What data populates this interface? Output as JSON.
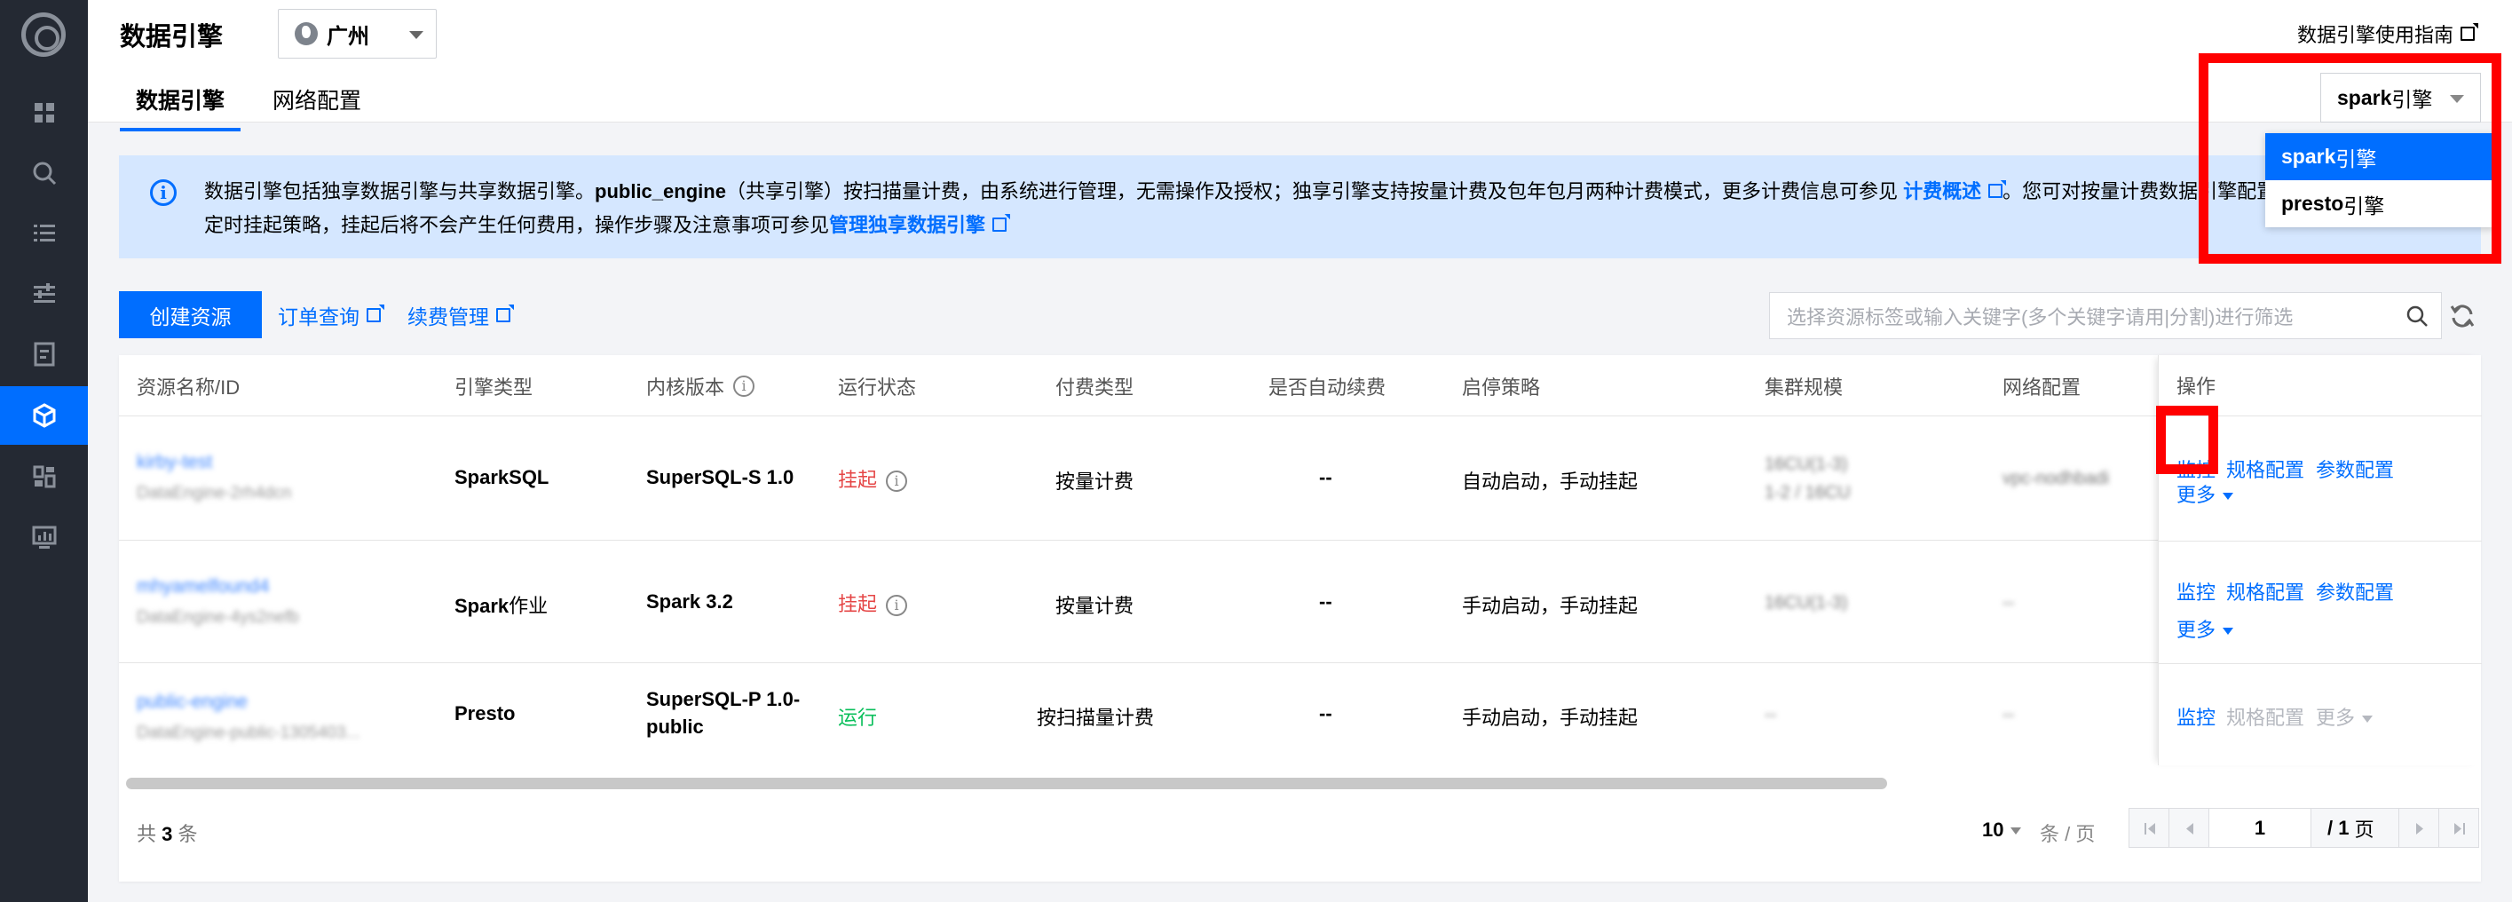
{
  "colors": {
    "primary": "#006eff",
    "nav_bg": "#242933",
    "banner_bg": "#d5e7ff",
    "stopped": "#e54545",
    "running": "#0abf5b",
    "highlight": "#ff0000"
  },
  "header": {
    "title": "数据引擎",
    "region": "广州",
    "guide_link": "数据引擎使用指南",
    "tabs": [
      {
        "label": "数据引擎"
      },
      {
        "label": "网络配置"
      }
    ]
  },
  "engine_select": {
    "value_strong": "spark",
    "value_suffix": "引擎",
    "options": [
      {
        "strong": "spark",
        "suffix": "引擎"
      },
      {
        "strong": "presto",
        "suffix": "引擎"
      }
    ]
  },
  "banner": {
    "t1": "数据引擎包括独享数据引擎与共享数据引擎。",
    "t2": "public_engine",
    "t3": "（共享引擎）按扫描量计费，由系统进行管理，无需操作及授权；独享引擎支持按量计费及包年包月两种计费模式，更多计费信息可参见 ",
    "link1": "计费概述",
    "t4": "。您可对按量计费数据引擎配置自动",
    "t5": "定时挂起策略，挂起后将不会产生任何费用，操作步骤及注意事项可参见",
    "link2": "管理独享数据引擎"
  },
  "toolbar": {
    "create": "创建资源",
    "order_query": "订单查询",
    "renew_mgmt": "续费管理",
    "search_placeholder": "选择资源标签或输入关键字(多个关键字请用|分割)进行筛选"
  },
  "table": {
    "columns": [
      "资源名称/ID",
      "引擎类型",
      "内核版本",
      "运行状态",
      "付费类型",
      "是否自动续费",
      "启停策略",
      "集群规模",
      "网络配置",
      "操作"
    ],
    "rows": [
      {
        "name": "kirby-test",
        "id": "DataEngine-2rh4dcn",
        "engine_type": "SparkSQL",
        "engine_type_suffix": "",
        "kernel": "SuperSQL-S 1.0",
        "kernel2": "",
        "status": "挂起",
        "status_kind": "stopped",
        "pay": "按量计费",
        "auto_renew": "--",
        "policy": "自动启动，手动挂起",
        "scale": "16CU(1-3)",
        "scale2": "1-2 / 16CU",
        "network": "vpc-nodhbadi",
        "ops": [
          {
            "label": "监控",
            "enabled": true
          },
          {
            "label": "规格配置",
            "enabled": true
          },
          {
            "label": "参数配置",
            "enabled": true
          },
          {
            "label": "更多",
            "enabled": true
          }
        ]
      },
      {
        "name": "mhyamelfound4",
        "id": "DataEngine-4ys2nefb",
        "engine_type": "Spark",
        "engine_type_suffix": "作业",
        "kernel": "Spark 3.2",
        "kernel2": "",
        "status": "挂起",
        "status_kind": "stopped",
        "pay": "按量计费",
        "auto_renew": "--",
        "policy": "手动启动，手动挂起",
        "scale": "16CU(1-3)",
        "scale2": "",
        "network": "--",
        "ops": [
          {
            "label": "监控",
            "enabled": true
          },
          {
            "label": "规格配置",
            "enabled": true
          },
          {
            "label": "参数配置",
            "enabled": true
          },
          {
            "label": "更多",
            "enabled": true
          }
        ]
      },
      {
        "name": "public-engine",
        "id": "DataEngine-public-1305403...",
        "engine_type": "Presto",
        "engine_type_suffix": "",
        "kernel": "SuperSQL-P 1.0-",
        "kernel2": "public",
        "status": "运行",
        "status_kind": "running",
        "pay": "按扫描量计费",
        "auto_renew": "--",
        "policy": "手动启动，手动挂起",
        "scale": "--",
        "scale2": "",
        "network": "--",
        "ops": [
          {
            "label": "监控",
            "enabled": true
          },
          {
            "label": "规格配置",
            "enabled": false
          },
          {
            "label": "更多",
            "enabled": false
          }
        ]
      }
    ]
  },
  "footer": {
    "total_prefix": "共",
    "total": "3",
    "total_suffix": "条",
    "page_size": "10",
    "page_size_unit": "条 / 页",
    "page": "1",
    "page_total": "/ 1",
    "page_unit": "页"
  }
}
